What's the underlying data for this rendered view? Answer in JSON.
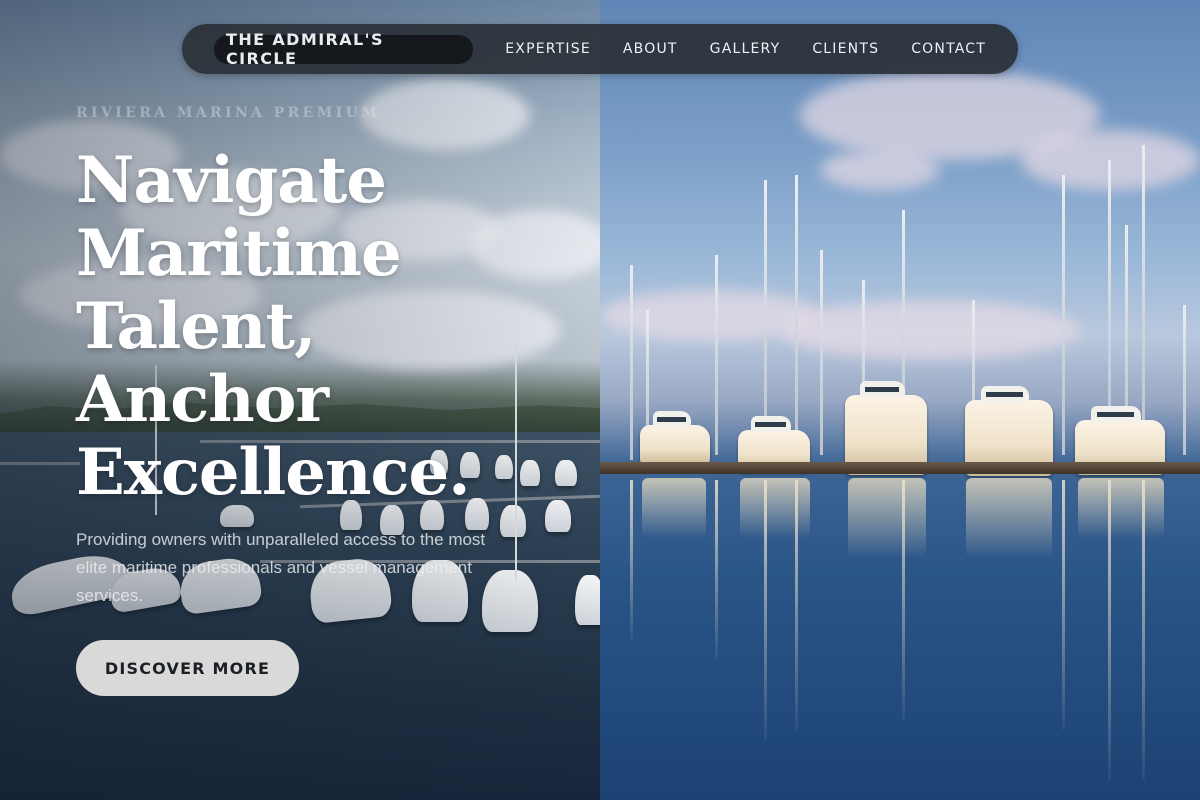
{
  "nav": {
    "brand": "THE ADMIRAL'S CIRCLE",
    "links": [
      "EXPERTISE",
      "ABOUT",
      "GALLERY",
      "CLIENTS",
      "CONTACT"
    ]
  },
  "hero": {
    "eyebrow": "RIVIERA MARINA PREMIUM",
    "headline_lines": [
      "Navigate",
      "Maritime",
      "Talent,",
      "Anchor",
      "Excellence."
    ],
    "description": "Providing owners with unparalleled access to the most elite maritime professionals and vessel management services.",
    "cta_label": "DISCOVER MORE"
  },
  "images": {
    "left": "aerial marina with moored motor yachts",
    "right": "marina with sailboat masts reflected in calm water"
  }
}
